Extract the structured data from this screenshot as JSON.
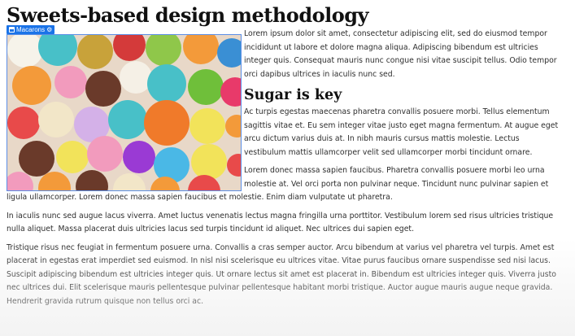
{
  "article": {
    "title": "Sweets-based design methodology",
    "image_tag": {
      "label": "Macarons",
      "icon": "image-icon",
      "settings_icon": "gear-icon"
    },
    "intro_paragraph": "Lorem ipsum dolor sit amet, consectetur adipiscing elit, sed do eiusmod tempor incididunt ut labore et dolore magna aliqua. Adipiscing bibendum est ultricies integer quis. Consequat mauris nunc congue nisi vitae suscipit tellus. Odio tempor orci dapibus ultrices in iaculis nunc sed.",
    "subheading": "Sugar is key",
    "paragraph_2": "Ac turpis egestas maecenas pharetra convallis posuere morbi. Tellus elementum sagittis vitae et. Eu sem integer vitae justo eget magna fermentum. At augue eget arcu dictum varius duis at. In nibh mauris cursus mattis molestie. Lectus vestibulum mattis ullamcorper velit sed ullamcorper morbi tincidunt ornare.",
    "paragraph_3": "Lorem donec massa sapien faucibus. Pharetra convallis posuere morbi leo urna molestie at. Vel orci porta non pulvinar neque. Tincidunt nunc pulvinar sapien et ligula ullamcorper. Lorem donec massa sapien faucibus et molestie. Enim diam vulputate ut pharetra.",
    "paragraph_4": "In iaculis nunc sed augue lacus viverra. Amet luctus venenatis lectus magna fringilla urna porttitor. Vestibulum lorem sed risus ultricies tristique nulla aliquet. Massa placerat duis ultricies lacus sed turpis tincidunt id aliquet. Nec ultrices dui sapien eget.",
    "paragraph_5": "Tristique risus nec feugiat in fermentum posuere urna. Convallis a cras semper auctor. Arcu bibendum at varius vel pharetra vel turpis. Amet est placerat in egestas erat imperdiet sed euismod. In nisl nisi scelerisque eu ultrices vitae. Vitae purus faucibus ornare suspendisse sed nisi lacus. Suscipit adipiscing bibendum est ultricies integer quis. Ut ornare lectus sit amet est placerat in. Bibendum est ultricies integer quis. Viverra justo nec ultrices dui. Elit scelerisque mauris pellentesque pulvinar pellentesque habitant morbi tristique. Auctor augue mauris augue neque gravida. Hendrerit gravida rutrum quisque non tellus orci ac."
  },
  "colors": {
    "selection_blue": "#1a73e8",
    "image_border": "#5b8ee6"
  }
}
